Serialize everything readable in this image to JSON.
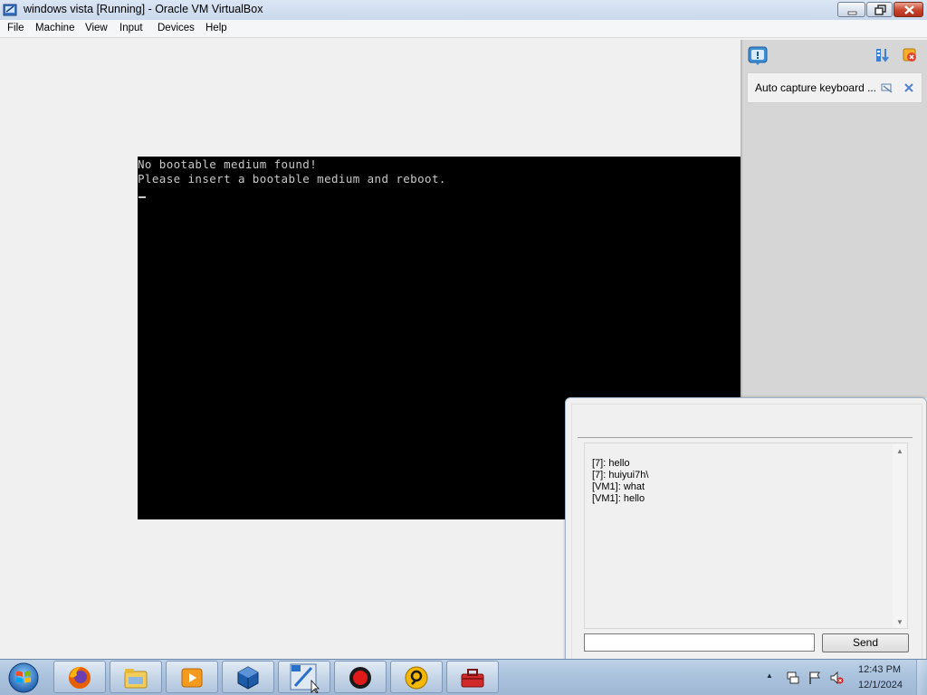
{
  "window": {
    "title": "windows vista [Running] - Oracle VM VirtualBox"
  },
  "menu": [
    "File",
    "Machine",
    "View",
    "Input",
    "Devices",
    "Help"
  ],
  "console": {
    "lines": [
      "No bootable medium found!",
      "Please insert a bootable medium and reboot."
    ]
  },
  "notification": {
    "message": "Auto capture keyboard ..."
  },
  "chat": {
    "messages": [
      "[7]: hello",
      "[7]: huiyui7h\\",
      "[VM1]: what",
      "[VM1]: hello"
    ],
    "input_value": "",
    "send_label": "Send"
  },
  "taskbar": {
    "apps": [
      "firefox-icon",
      "file-explorer-icon",
      "media-player-icon",
      "virtualbox-icon",
      "vista-vm-icon",
      "record-icon",
      "remote-desktop-icon",
      "toolbox-icon"
    ]
  },
  "tray": {
    "time": "12:43 PM",
    "date": "12/1/2024"
  },
  "colors": {
    "vm_background": "#000000",
    "console_text": "#c8c8c8",
    "window_background": "#f0f0f0",
    "taskbar": "#a9c1dc"
  }
}
